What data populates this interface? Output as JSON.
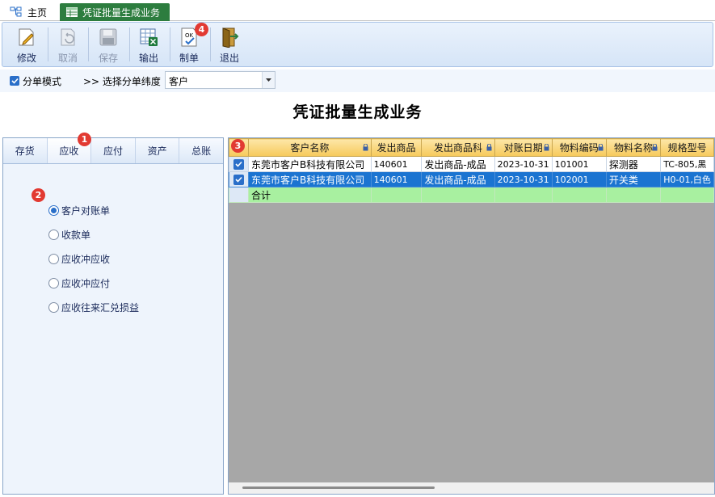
{
  "tabs": {
    "home": "主页",
    "active": "凭证批量生成业务"
  },
  "toolbar": {
    "modify": "修改",
    "cancel": "取消",
    "save": "保存",
    "export": "输出",
    "make": "制单",
    "exit": "退出"
  },
  "options": {
    "split_mode": "分单模式",
    "dimension_label": ">> 选择分单纬度",
    "dimension_value": "客户"
  },
  "page_title": "凭证批量生成业务",
  "left_tabs": [
    "存货",
    "应收",
    "应付",
    "资产",
    "总账"
  ],
  "radio_items": [
    "客户对账单",
    "收款单",
    "应收冲应收",
    "应收冲应付",
    "应收往来汇兑损益"
  ],
  "badges": [
    "1",
    "2",
    "3",
    "4"
  ],
  "grid": {
    "columns": [
      "客户名称",
      "发出商品",
      "发出商品科",
      "对账日期",
      "物料编码",
      "物料名称",
      "规格型号"
    ],
    "rows": [
      [
        "东莞市客户B科技有限公司",
        "140601",
        "发出商品-成品",
        "2023-10-31",
        "101001",
        "探测器",
        "TC-805,黑"
      ],
      [
        "东莞市客户B科技有限公司",
        "140601",
        "发出商品-成品",
        "2023-10-31",
        "102001",
        "开关类",
        "H0-01,白色"
      ]
    ],
    "summary_label": "合计"
  },
  "colors": {
    "accent": "#2a6fc9",
    "active_tab": "#2d7d3f",
    "badge": "#e23a32",
    "selected_row": "#1b74d1",
    "summary_row": "#a8f0a0"
  }
}
